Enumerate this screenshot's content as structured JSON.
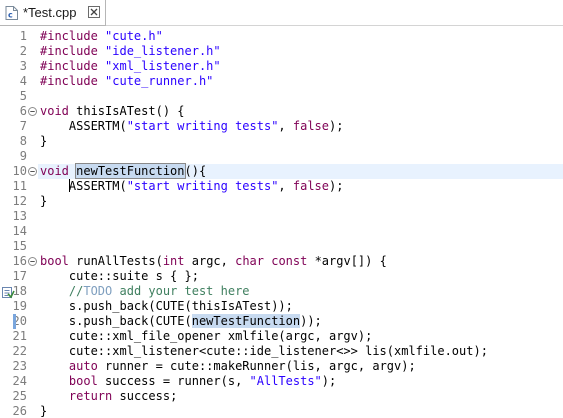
{
  "tab": {
    "title": "*Test.cpp",
    "icon": "cpp-file-icon",
    "close_icon": "close-icon"
  },
  "colors": {
    "keyword": "#7f0055",
    "string": "#2a00ff",
    "comment": "#3f7f5f",
    "todo": "#7f9fbf",
    "occurrence": "#c7daf0",
    "current_line": "#e8f2fe",
    "line_number": "#7d7d7d"
  },
  "lines": [
    {
      "n": "1",
      "segs": [
        [
          "kw",
          "#include"
        ],
        [
          "",
          ""
        ],
        [
          "st",
          "\"cute.h\""
        ]
      ]
    },
    {
      "n": "2",
      "segs": [
        [
          "kw",
          "#include"
        ],
        [
          "",
          ""
        ],
        [
          "st",
          "\"ide_listener.h\""
        ]
      ]
    },
    {
      "n": "3",
      "segs": [
        [
          "kw",
          "#include"
        ],
        [
          "",
          ""
        ],
        [
          "st",
          "\"xml_listener.h\""
        ]
      ]
    },
    {
      "n": "4",
      "segs": [
        [
          "kw",
          "#include"
        ],
        [
          "",
          ""
        ],
        [
          "st",
          "\"cute_runner.h\""
        ]
      ]
    },
    {
      "n": "5",
      "segs": []
    },
    {
      "n": "6",
      "fold": true,
      "segs": [
        [
          "kw",
          "void"
        ],
        [
          "",
          " thisIsATest() {"
        ]
      ]
    },
    {
      "n": "7",
      "segs": [
        [
          "",
          "    ASSERTM("
        ],
        [
          "st",
          "\"start writing tests\""
        ],
        [
          "",
          ", "
        ],
        [
          "kw",
          "false"
        ],
        [
          "",
          ");"
        ]
      ]
    },
    {
      "n": "8",
      "segs": [
        [
          "",
          "}"
        ]
      ]
    },
    {
      "n": "9",
      "segs": []
    },
    {
      "n": "10",
      "fold": true,
      "highlight": true,
      "segs": [
        [
          "kw",
          "void"
        ],
        [
          "",
          " "
        ],
        [
          "occbox",
          "newTestFunction"
        ],
        [
          "",
          "(){"
        ]
      ]
    },
    {
      "n": "11",
      "caret": true,
      "segs": [
        [
          "",
          "    "
        ],
        [
          "caret",
          ""
        ],
        [
          "",
          "ASSERTM("
        ],
        [
          "st",
          "\"start writing tests\""
        ],
        [
          "",
          ", "
        ],
        [
          "kw",
          "false"
        ],
        [
          "",
          ");"
        ]
      ]
    },
    {
      "n": "12",
      "segs": [
        [
          "",
          "}"
        ]
      ]
    },
    {
      "n": "13",
      "segs": []
    },
    {
      "n": "14",
      "segs": []
    },
    {
      "n": "15",
      "segs": []
    },
    {
      "n": "16",
      "fold": true,
      "segs": [
        [
          "kw",
          "bool"
        ],
        [
          "",
          " runAllTests("
        ],
        [
          "kw",
          "int"
        ],
        [
          "",
          " argc, "
        ],
        [
          "kw",
          "char const"
        ],
        [
          "",
          " *argv[]) {"
        ]
      ]
    },
    {
      "n": "17",
      "segs": [
        [
          "",
          "    cute::suite s { };"
        ]
      ]
    },
    {
      "n": "18",
      "todo": true,
      "segs": [
        [
          "",
          "    "
        ],
        [
          "cm",
          "//"
        ],
        [
          "td",
          "TODO"
        ],
        [
          "cm",
          " add your test here"
        ]
      ]
    },
    {
      "n": "19",
      "segs": [
        [
          "",
          "    s.push_back(CUTE(thisIsATest));"
        ]
      ]
    },
    {
      "n": "20",
      "occmark": true,
      "segs": [
        [
          "",
          "    s.push_back(CUTE("
        ],
        [
          "occ",
          "newTestFunction"
        ],
        [
          "",
          "));"
        ]
      ]
    },
    {
      "n": "21",
      "segs": [
        [
          "",
          "    cute::xml_file_opener xmlfile(argc, argv);"
        ]
      ]
    },
    {
      "n": "22",
      "segs": [
        [
          "",
          "    cute::xml_listener<cute::ide_listener<>> lis(xmlfile.out);"
        ]
      ]
    },
    {
      "n": "23",
      "segs": [
        [
          "",
          "    "
        ],
        [
          "kw",
          "auto"
        ],
        [
          "",
          " runner = cute::makeRunner(lis, argc, argv);"
        ]
      ]
    },
    {
      "n": "24",
      "segs": [
        [
          "",
          "    "
        ],
        [
          "kw",
          "bool"
        ],
        [
          "",
          " success = runner(s, "
        ],
        [
          "st",
          "\"AllTests\""
        ],
        [
          "",
          ");"
        ]
      ]
    },
    {
      "n": "25",
      "segs": [
        [
          "",
          "    "
        ],
        [
          "kw",
          "return"
        ],
        [
          "",
          " success;"
        ]
      ]
    },
    {
      "n": "26",
      "segs": [
        [
          "",
          "}"
        ]
      ]
    }
  ]
}
